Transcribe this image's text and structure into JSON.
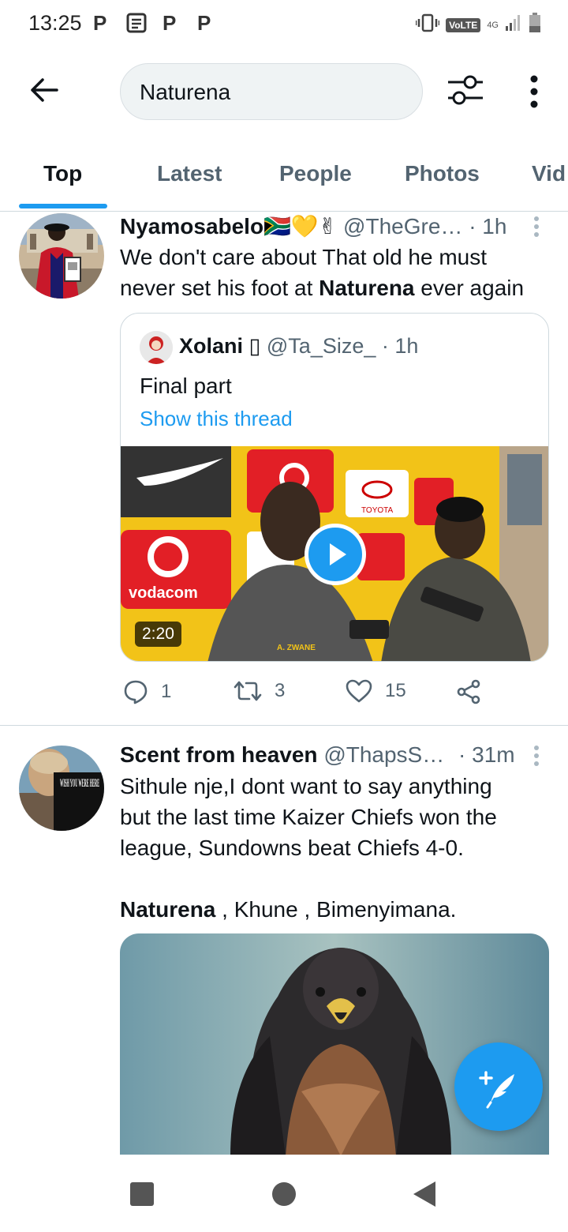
{
  "status_bar": {
    "time": "13:25",
    "notification_icons": [
      "P",
      "P",
      "P"
    ],
    "volte": "VoLTE",
    "network": "4G"
  },
  "search": {
    "query": "Naturena"
  },
  "tabs": [
    {
      "label": "Top",
      "active": true
    },
    {
      "label": "Latest",
      "active": false
    },
    {
      "label": "People",
      "active": false
    },
    {
      "label": "Photos",
      "active": false
    },
    {
      "label": "Vid",
      "active": false
    }
  ],
  "tweets": [
    {
      "display_name": "Nyamosabelo🇿🇦💛✌",
      "handle": "@TheGre…",
      "time": "· 1h",
      "text_line1": "We don't care about That old he must",
      "text_line2_pre": "never set his foot at ",
      "text_line2_bold": "Naturena",
      "text_line2_post": " ever again",
      "quote": {
        "display_name": "Xolani ▯",
        "handle": "@Ta_Size_",
        "time": "· 1h",
        "text": "Final part",
        "link": "Show this thread",
        "video_duration": "2:20",
        "video_brand_text": "vodacom",
        "video_brand_text_2": "TOYOTA",
        "video_jacket_text": "A. ZWANE"
      },
      "replies": "1",
      "retweets": "3",
      "likes": "15"
    },
    {
      "display_name": "Scent from heaven",
      "handle": "@ThapsS…",
      "time": "· 31m",
      "text_line1": "Sithule nje,I dont want to say anything",
      "text_line2": "but the last time Kaizer Chiefs won the",
      "text_line3": "league, Sundowns beat Chiefs 4-0.",
      "text_line4_bold": "Naturena",
      "text_line4_post": " , Khune , Bimenyimana.",
      "avatar_text": "WISH YOU WERE HERE"
    }
  ],
  "colors": {
    "accent": "#1d9bf0",
    "text_primary": "#0f1419",
    "text_secondary": "#536471",
    "border": "#cfd9de"
  }
}
